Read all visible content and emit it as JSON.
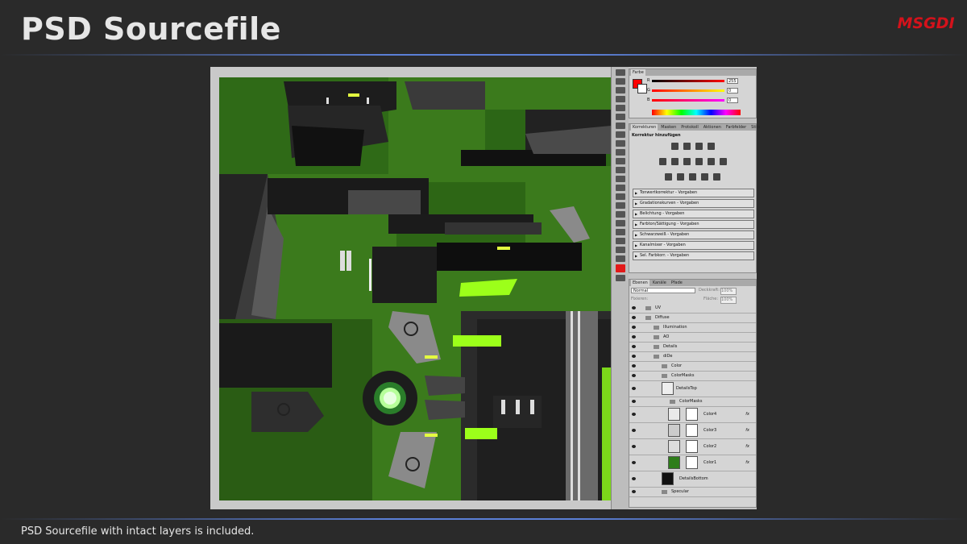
{
  "slide": {
    "title": "PSD Sourcefile",
    "logo": "MSGDI",
    "caption": "PSD Sourcefile with intact layers is included.",
    "accent_color": "#5b7fd6",
    "logo_color": "#d4121b"
  },
  "color_panel": {
    "tab": "Farbe",
    "channels": [
      {
        "label": "R",
        "value": "255"
      },
      {
        "label": "G",
        "value": "0"
      },
      {
        "label": "B",
        "value": "0"
      }
    ],
    "foreground_color": "#ff0000"
  },
  "adjustments_panel": {
    "tabs": [
      "Korrekturen",
      "Masken",
      "Protokoll",
      "Aktionen",
      "Farbfelder",
      "Stile"
    ],
    "heading": "Korrektur hinzufügen",
    "presets": [
      "Tonwertkorrektur - Vorgaben",
      "Gradationskurven - Vorgaben",
      "Belichtung - Vorgaben",
      "Farbton/Sättigung - Vorgaben",
      "Schwarzweiß - Vorgaben",
      "Kanalmixer - Vorgaben",
      "Sel. Farbkorr. - Vorgaben"
    ]
  },
  "layers_panel": {
    "tabs": [
      "Ebenen",
      "Kanäle",
      "Pfade"
    ],
    "blend_mode": "Normal",
    "opacity_label": "Deckkraft:",
    "opacity_value": "100%",
    "fill_label": "Fläche:",
    "fill_value": "100%",
    "lock_label": "Fixieren:",
    "layers": [
      {
        "name": "UV",
        "kind": "group",
        "indent": 0
      },
      {
        "name": "Diffuse",
        "kind": "group",
        "indent": 0,
        "open": true
      },
      {
        "name": "Illumination",
        "kind": "group",
        "indent": 1
      },
      {
        "name": "AO",
        "kind": "group",
        "indent": 1
      },
      {
        "name": "Details",
        "kind": "group",
        "indent": 1
      },
      {
        "name": "diDe",
        "kind": "group",
        "indent": 1,
        "open": true
      },
      {
        "name": "Color",
        "kind": "group",
        "indent": 2
      },
      {
        "name": "ColorMasks",
        "kind": "group",
        "indent": 2,
        "open": true
      },
      {
        "name": "DetailsTop",
        "kind": "layer",
        "indent": 2
      },
      {
        "name": "ColorMasks",
        "kind": "group",
        "indent": 3,
        "open": true
      },
      {
        "name": "Color4",
        "kind": "layer",
        "indent": 3,
        "fx": "fx"
      },
      {
        "name": "Color3",
        "kind": "layer",
        "indent": 3,
        "fx": "fx"
      },
      {
        "name": "Color2",
        "kind": "layer",
        "indent": 3,
        "fx": "fx"
      },
      {
        "name": "Color1",
        "kind": "layer",
        "indent": 3,
        "fx": "fx"
      },
      {
        "name": "DetailsBottom",
        "kind": "layer",
        "indent": 2
      },
      {
        "name": "Specular",
        "kind": "group",
        "indent": 1
      }
    ]
  },
  "canvas": {
    "base_color": "#3d7a1f",
    "accent_color": "#9cff1a"
  }
}
